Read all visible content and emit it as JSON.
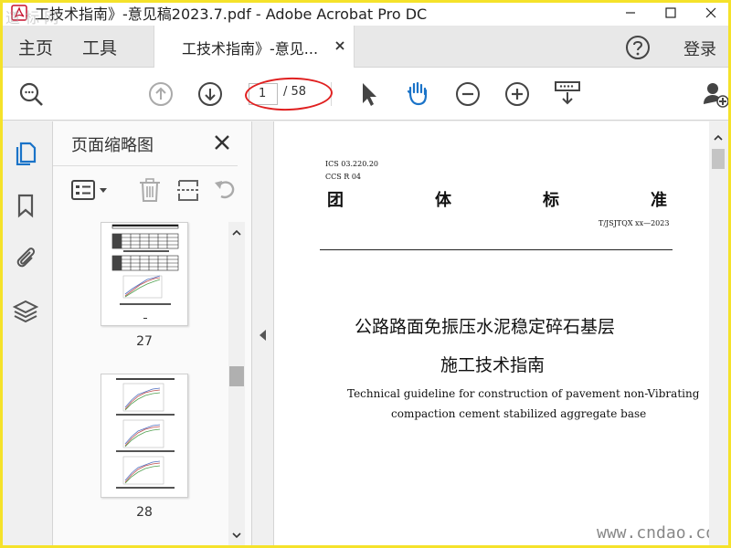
{
  "window": {
    "title": "工技术指南》-意见稿2023.7.pdf - Adobe Acrobat Pro DC",
    "corner_watermark": "道 标 网"
  },
  "tabs": {
    "home": "主页",
    "tools": "工具",
    "document": "工技术指南》-意见...",
    "login": "登录"
  },
  "toolbar": {
    "current_page": "1",
    "page_total": "/ 58"
  },
  "panel": {
    "title": "页面缩略图",
    "thumbnails": [
      {
        "number": "27"
      },
      {
        "number": "28"
      }
    ]
  },
  "document": {
    "ics": "ICS 03.220.20",
    "ccs": "CCS R 04",
    "standard_type": [
      "团",
      "体",
      "标",
      "准"
    ],
    "code": "T/JSJTQX  xx—2023",
    "title_line1": "公路路面免振压水泥稳定碎石基层",
    "title_line2": "施工技术指南",
    "en_line1": "Technical guideline for construction of pavement non-Vibrating",
    "en_line2": "compaction cement stabilized aggregate base",
    "watermark": "www.cndao.com"
  },
  "colors": {
    "accent_blue": "#1a73c8",
    "highlight_red": "#e02020",
    "frame_yellow": "#f5e22a"
  }
}
